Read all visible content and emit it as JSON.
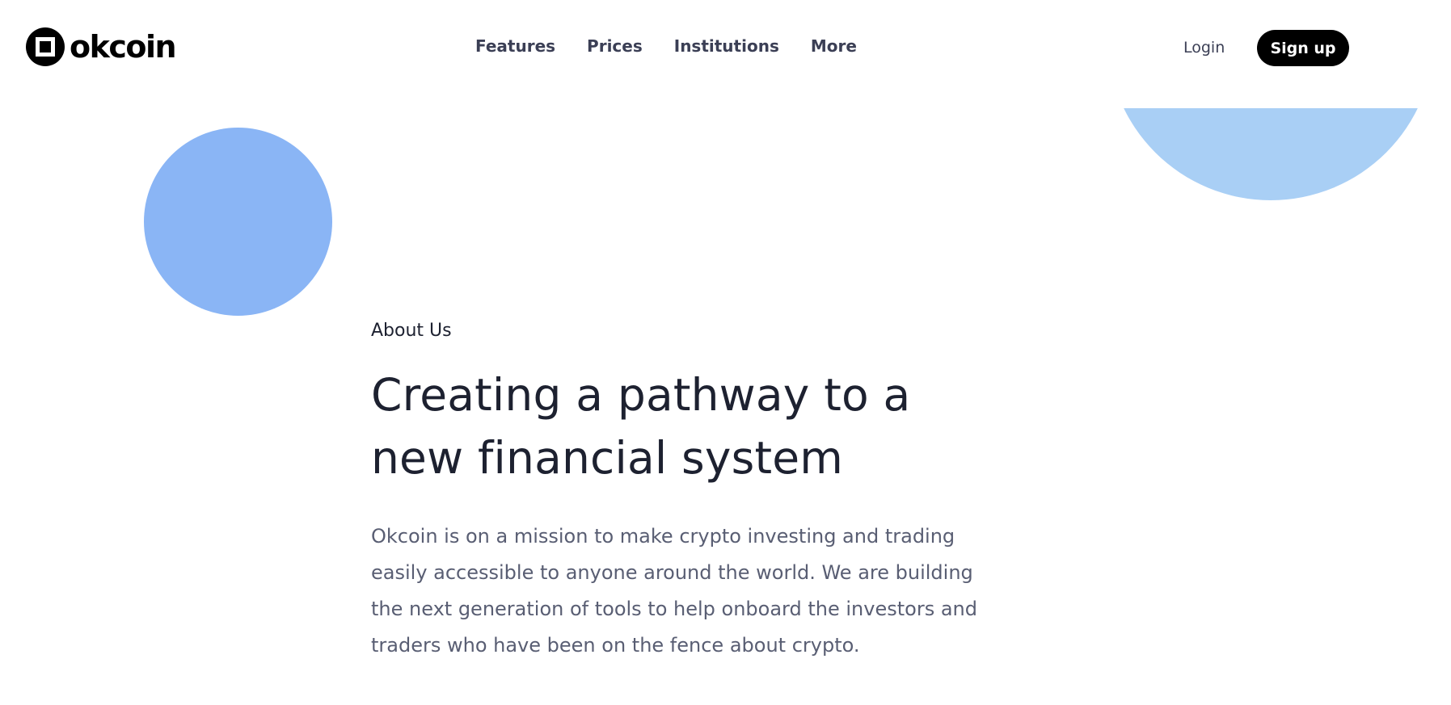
{
  "header": {
    "brand": "okcoin",
    "nav": [
      {
        "label": "Features"
      },
      {
        "label": "Prices"
      },
      {
        "label": "Institutions"
      },
      {
        "label": "More"
      }
    ],
    "login_label": "Login",
    "signup_label": "Sign up"
  },
  "hero": {
    "eyebrow": "About Us",
    "headline": "Creating a pathway to a new financial system",
    "description": "Okcoin is on a mission to make crypto investing and trading easily accessible to anyone around the world. We are building the next generation of tools to help onboard the investors and traders who have been on the fence about crypto."
  },
  "colors": {
    "accent_circle": "#8ab5f5",
    "accent_half_circle": "#a9cff5",
    "signup_bg": "#000000",
    "heading_text": "#1d2130",
    "body_text": "#595e73",
    "nav_text": "#3b3f55"
  },
  "icons": {
    "logo": "okcoin-logo-icon"
  }
}
